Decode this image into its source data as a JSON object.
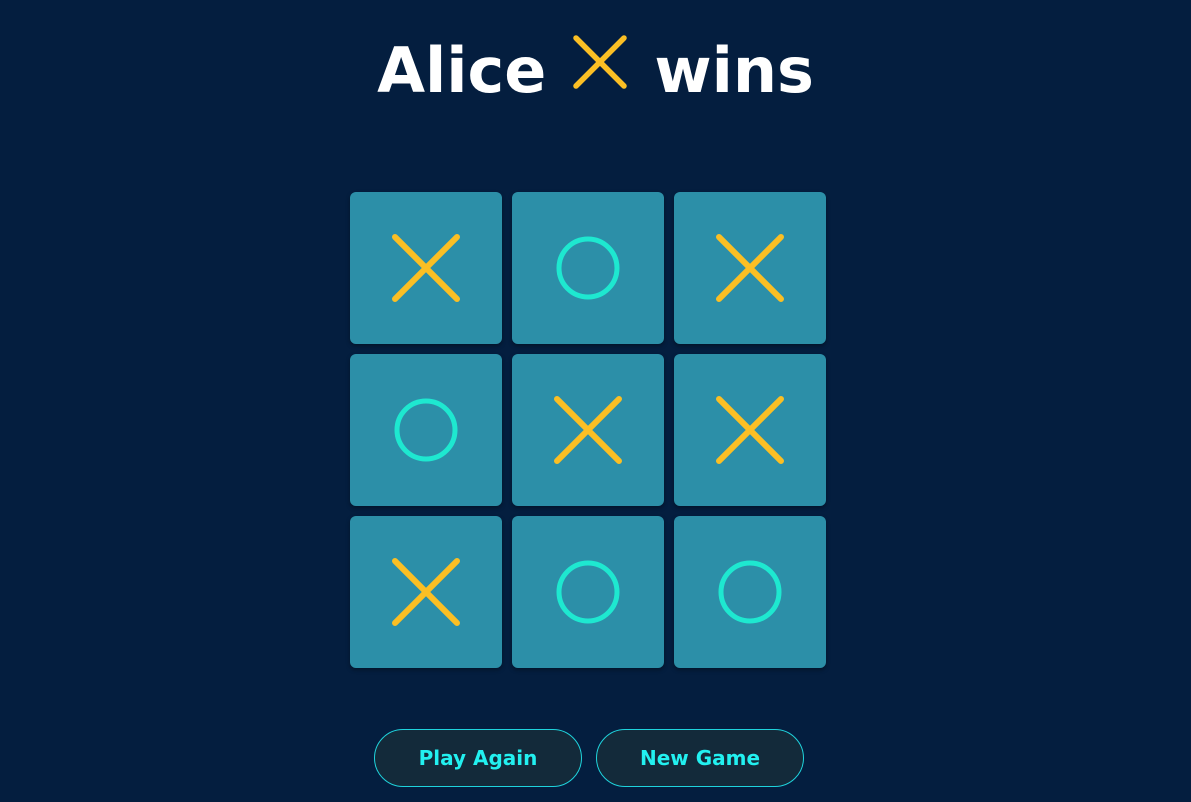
{
  "header": {
    "winner_name": "Alice",
    "winner_mark": "X",
    "result_word": "wins"
  },
  "board": {
    "cells": [
      "X",
      "O",
      "X",
      "O",
      "X",
      "X",
      "X",
      "O",
      "O"
    ]
  },
  "buttons": {
    "play_again_label": "Play Again",
    "new_game_label": "New Game"
  },
  "colors": {
    "background": "#041e3f",
    "cell": "#2c8fa8",
    "x_mark": "#fbbf24",
    "o_mark": "#1ee8d0",
    "button_text": "#22f0f0",
    "button_border": "#1fd3dc",
    "button_bg": "#132a3a",
    "title_text": "#ffffff"
  },
  "icons": {
    "x_mark": "x-mark-icon",
    "o_mark": "o-mark-icon"
  }
}
